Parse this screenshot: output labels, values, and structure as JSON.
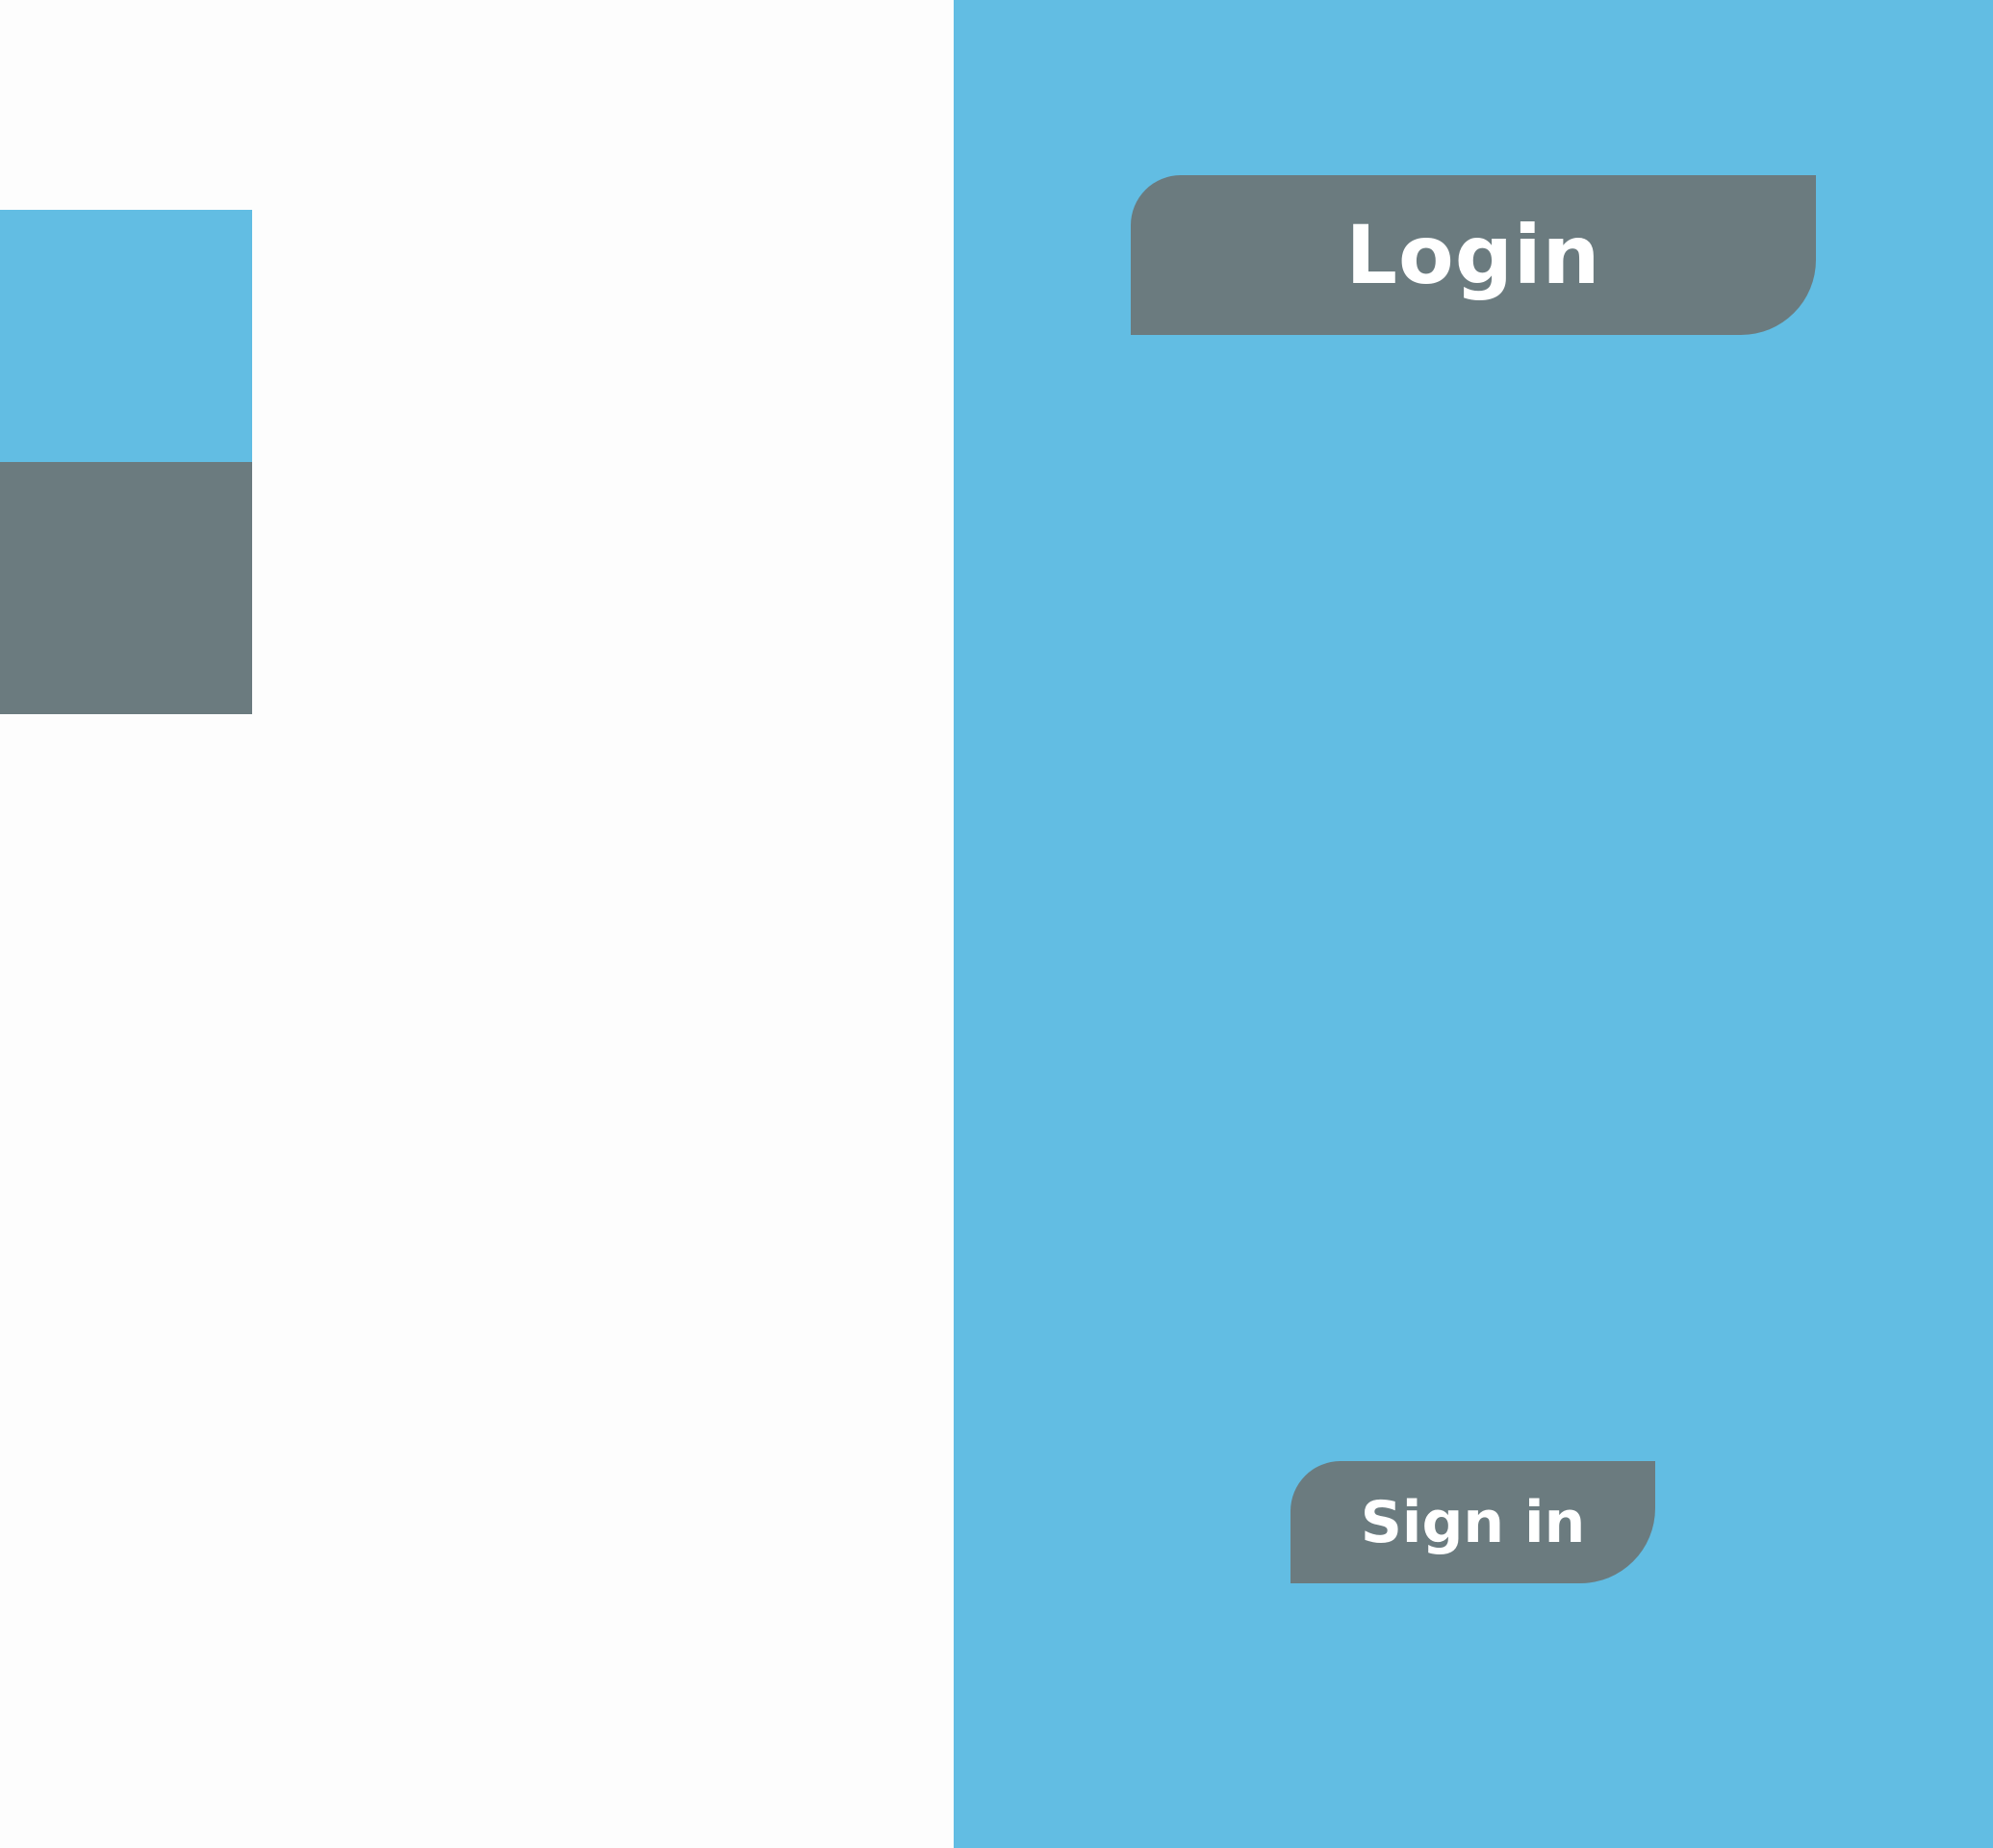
{
  "colors": {
    "accent_blue": "#62bde3",
    "accent_gray": "#6b7b7f",
    "background": "#fdfdfd",
    "text_light": "#ffffff"
  },
  "palette": {
    "swatches": [
      "#62bde3",
      "#6b7b7f"
    ]
  },
  "login_panel": {
    "header": {
      "title": "Login"
    },
    "submit": {
      "label": "Sign in"
    }
  }
}
